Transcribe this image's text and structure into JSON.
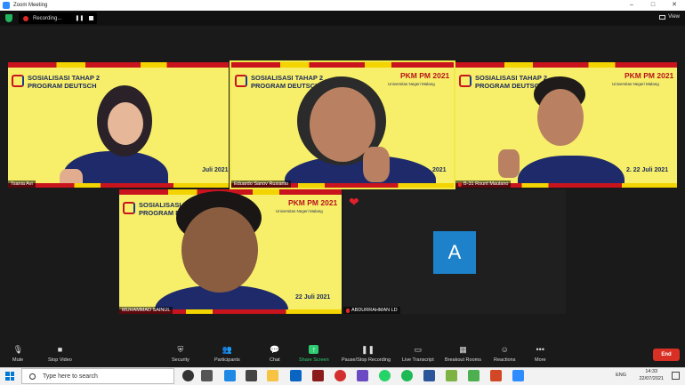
{
  "window": {
    "title": "Zoom Meeting",
    "controls": [
      "–",
      "□",
      "✕"
    ]
  },
  "recording": {
    "label": "Recording..."
  },
  "view": {
    "label": "View"
  },
  "banner": {
    "title_line1": "SOSIALISASI TAHAP 2",
    "title_line2": "PROGRAM DEUTSCH",
    "pkm": "PKM PM 2021",
    "university": "Universitas Negeri Malang",
    "date": "22 Juli 2021",
    "date_partial_1": "Juli 2021",
    "date_partial_2": "2021",
    "date_partial_3": "2. 22 Juli 2021"
  },
  "participants": [
    {
      "name": "Tsania Avi",
      "muted": false
    },
    {
      "name": "Eduardo Sanov Rusianto",
      "muted": false,
      "active": true
    },
    {
      "name": "B-31 Rount Maulano",
      "muted": true
    },
    {
      "name": "MUHAMMAD SAINUL",
      "muted": false
    },
    {
      "name": "ABDURRAHMAN LD",
      "muted": true,
      "avatar_letter": "A",
      "avatar_color": "#1d82c9"
    }
  ],
  "toolbar": {
    "mute": "Mute",
    "stop_video": "Stop Video",
    "security": "Security",
    "participants": "Participants",
    "participants_count": "5",
    "chat": "Chat",
    "share_screen": "Share Screen",
    "pause_recording": "Pause/Stop Recording",
    "live_transcript": "Live Transcript",
    "breakout_rooms": "Breakout Rooms",
    "reactions": "Reactions",
    "more": "More",
    "end": "End"
  },
  "taskbar": {
    "search_placeholder": "Type here to search",
    "language": "ENG",
    "time": "14:33",
    "date": "22/07/2021"
  },
  "colors": {
    "banner_yellow": "#f7ef6a",
    "banner_red": "#c9141e",
    "zoom_blue": "#2d8cff",
    "end_red": "#d93025",
    "share_green": "#2ecc71"
  }
}
